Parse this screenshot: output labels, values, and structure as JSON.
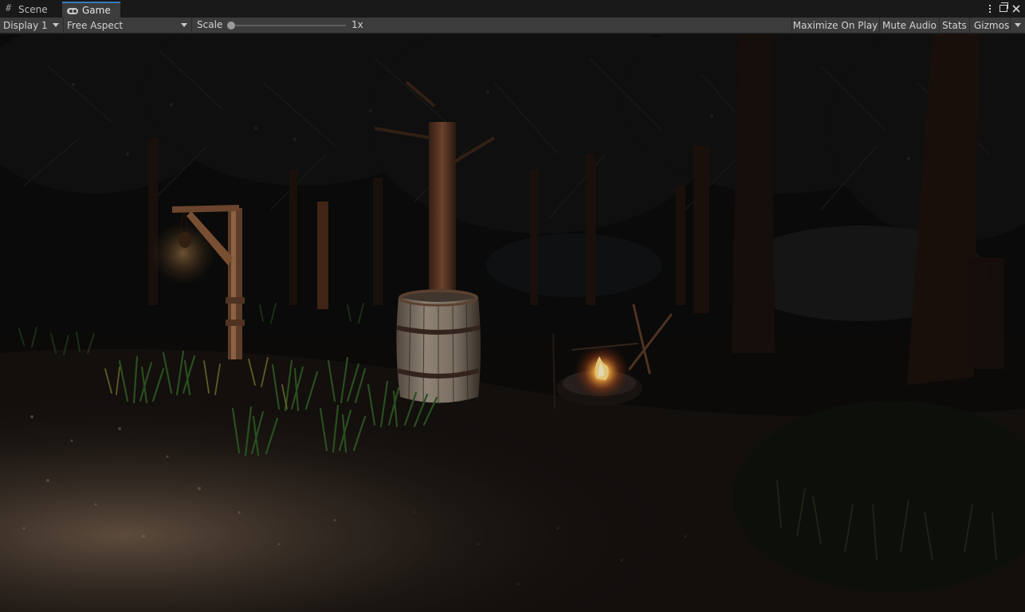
{
  "tabs": [
    {
      "label": "Scene",
      "icon": "hash-icon"
    },
    {
      "label": "Game",
      "icon": "gamepad-icon",
      "active": true
    }
  ],
  "toolbar": {
    "display_label": "Display 1",
    "aspect_label": "Free Aspect",
    "scale_label": "Scale",
    "scale_value": "1x",
    "scale_slider_fraction": 0.0,
    "maximize_label": "Maximize On Play",
    "mute_label": "Mute Audio",
    "stats_label": "Stats",
    "gizmos_label": "Gizmos"
  },
  "colors": {
    "active_tab_accent": "#3a79bb",
    "toolbar_bg": "#3c3c3c",
    "tabbar_bg": "#191919",
    "fire_glow": "#ffb347",
    "lantern_glow": "#d9a060"
  }
}
